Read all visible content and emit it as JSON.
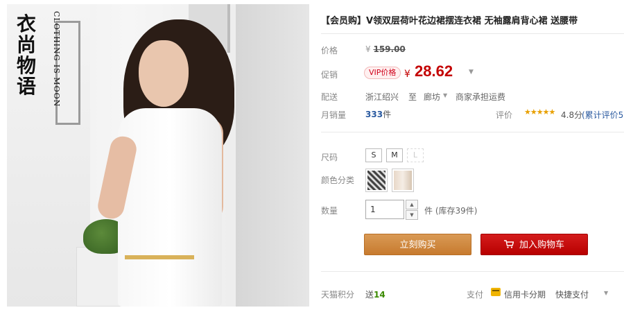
{
  "brand": {
    "cn": "衣尚物语",
    "en": "CLOTHING IS MOON"
  },
  "product": {
    "title": "【会员购】V领双层荷叶花边裙摆连衣裙 无袖露肩背心裙 送腰带"
  },
  "price": {
    "label": "价格",
    "currency": "¥",
    "original": "159.00",
    "promo_label": "促销",
    "vip_badge": "VIP价格",
    "current": "28.62"
  },
  "shipping": {
    "label": "配送",
    "from": "浙江绍兴",
    "to_word": "至",
    "destination": "廊坊",
    "fee_note": "商家承担运费"
  },
  "sales": {
    "label": "月销量",
    "count": "333",
    "unit": "件",
    "rating_label": "评价",
    "stars": "★★★★★",
    "score": "4.8分",
    "review_count": "(累计评价5)"
  },
  "size": {
    "label": "尺码",
    "options": [
      "S",
      "M",
      "L"
    ]
  },
  "color": {
    "label": "颜色分类"
  },
  "quantity": {
    "label": "数量",
    "value": "1",
    "unit_stock": "件 (库存39件)"
  },
  "buttons": {
    "buy_now": "立刻购买",
    "add_cart": "加入购物车"
  },
  "points": {
    "label": "天猫积分",
    "give": "送",
    "value": "14"
  },
  "payment": {
    "label": "支付",
    "credit": "信用卡分期",
    "quick": "快捷支付"
  },
  "colors": {
    "price_red": "#c40000",
    "buy_button": "#c77a2e",
    "cart_button": "#b80000",
    "star": "#e8a000"
  }
}
